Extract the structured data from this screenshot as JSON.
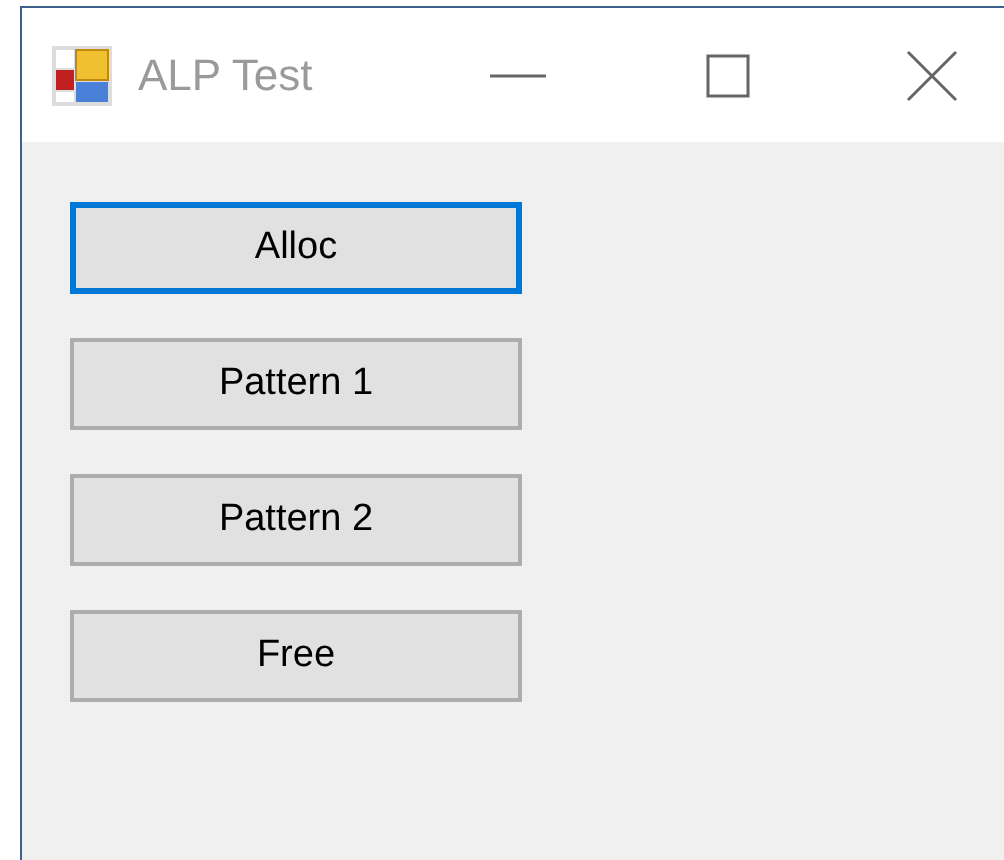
{
  "window": {
    "title": "ALP Test"
  },
  "buttons": [
    {
      "label": "Alloc",
      "focused": true
    },
    {
      "label": "Pattern 1",
      "focused": false
    },
    {
      "label": "Pattern 2",
      "focused": false
    },
    {
      "label": "Free",
      "focused": false
    }
  ]
}
